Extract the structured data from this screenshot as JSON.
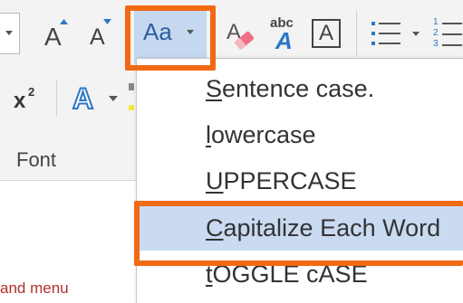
{
  "ribbon": {
    "group_label": "Font",
    "change_case_label": "Aa",
    "grow_font_glyph": "A",
    "shrink_font_glyph": "A",
    "superscript_label": "x",
    "superscript_sup": "2",
    "text_effects_glyph": "A",
    "spell_abc": "abc",
    "spell_glyph": "A",
    "char_border_glyph": "A",
    "numbering_digits": [
      "1",
      "2",
      "3"
    ]
  },
  "change_case_menu": {
    "items": [
      {
        "mnemonic": "S",
        "rest": "entence case.",
        "selected": false
      },
      {
        "mnemonic": "l",
        "rest": "owercase",
        "selected": false
      },
      {
        "mnemonic": "U",
        "rest": "PPERCASE",
        "selected": false
      },
      {
        "mnemonic": "C",
        "rest": "apitalize Each Word",
        "selected": true
      },
      {
        "mnemonic": "t",
        "rest": "OGGLE cASE",
        "selected": false
      }
    ]
  },
  "caption": "and menu",
  "colors": {
    "highlight_orange": "#f06a14",
    "selected_item_bg": "#c9daf1",
    "pressed_button_bg": "#c5d8ef",
    "ribbon_bg": "#f3f3f3",
    "caption_red": "#b12f29",
    "accent_blue": "#2b78c5"
  },
  "icons": {
    "grow_font": "grow-font-icon",
    "shrink_font": "shrink-font-icon",
    "change_case": "change-case-icon",
    "clear_formatting": "clear-formatting-icon",
    "phonetic_guide": "phonetic-guide-icon",
    "character_border": "character-border-icon",
    "bullets": "bullets-icon",
    "numbering": "numbering-icon",
    "superscript": "superscript-icon",
    "text_effects": "text-effects-icon"
  }
}
